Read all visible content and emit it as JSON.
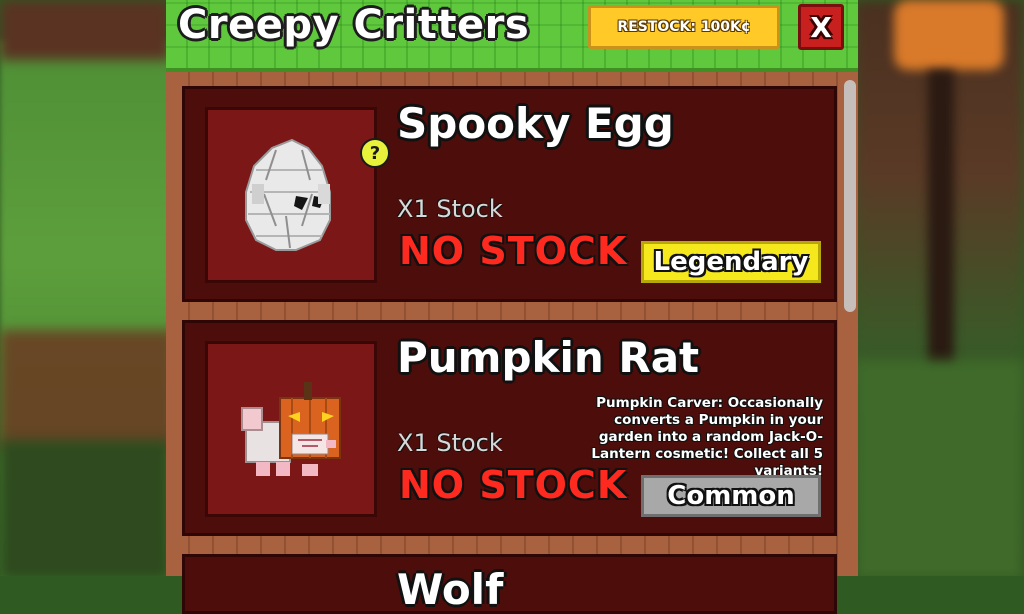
{
  "header": {
    "title": "Creepy Critters",
    "restock_label": "RESTOCK: 100K¢",
    "close_label": "X"
  },
  "items": [
    {
      "name": "Spooky Egg",
      "stock_text": "X1 Stock",
      "status": "NO STOCK",
      "rarity": "Legendary",
      "help": "?",
      "icon": "spooky-egg-icon"
    },
    {
      "name": "Pumpkin Rat",
      "stock_text": "X1 Stock",
      "status": "NO STOCK",
      "rarity": "Common",
      "description": "Pumpkin Carver: Occasionally converts a Pumpkin in your garden into a random Jack-O-Lantern cosmetic! Collect all 5 variants!",
      "icon": "pumpkin-rat-icon"
    },
    {
      "name": "Wolf"
    }
  ],
  "colors": {
    "header_green": "#5fc83c",
    "card_bg": "#4d0d0b",
    "no_stock_red": "#ff2a1f",
    "legendary_yellow": "#f5e81c",
    "common_gray": "#a8a8a8",
    "restock_gold": "#ffc928",
    "close_red": "#c8201e"
  }
}
